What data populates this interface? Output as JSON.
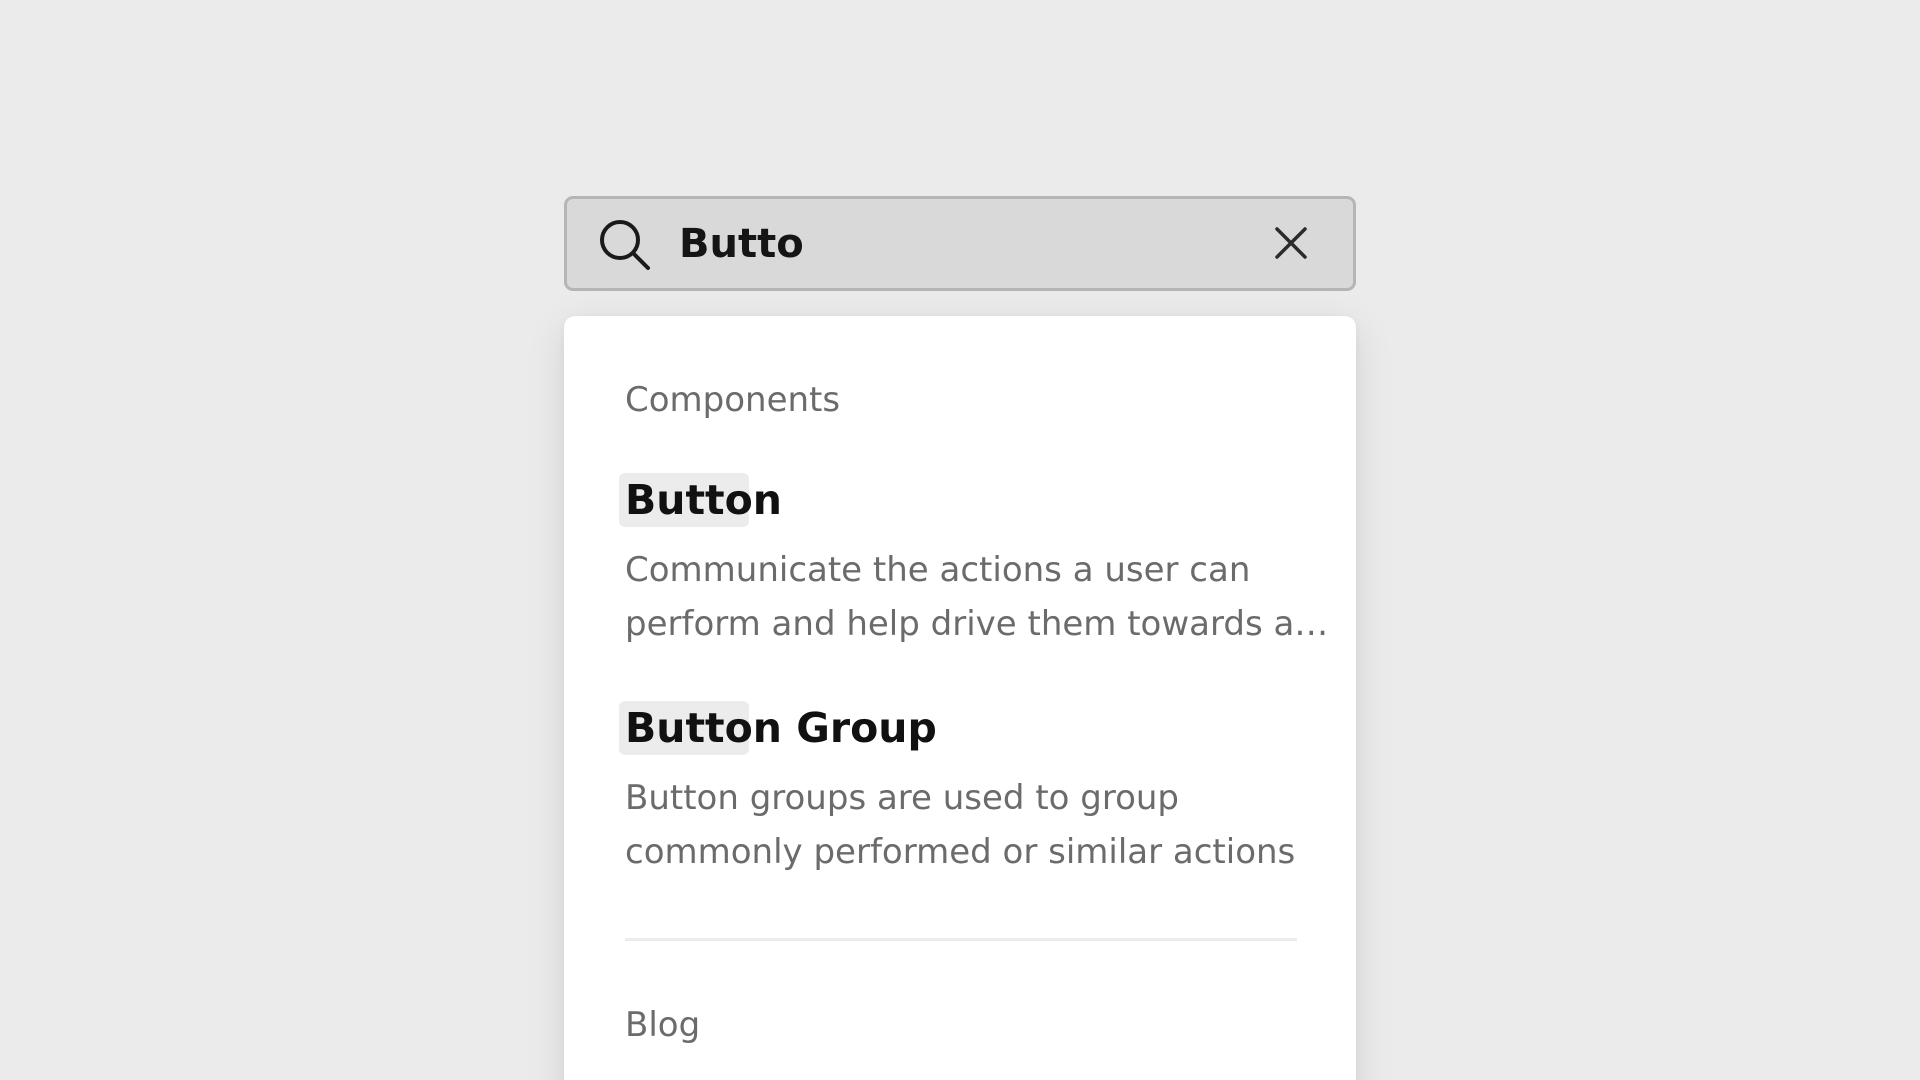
{
  "search": {
    "value": "Butto",
    "placeholder": ""
  },
  "results": {
    "sections": [
      {
        "label": "Components",
        "items": [
          {
            "title": "Button",
            "description_lines": [
              "Communicate the actions a user can",
              "perform and help drive them towards a…"
            ]
          },
          {
            "title": "Button Group",
            "description_lines": [
              "Button groups are used to group",
              "commonly performed or similar actions"
            ]
          }
        ]
      },
      {
        "label": "Blog",
        "items": []
      }
    ]
  },
  "icons": {
    "search": "search-icon",
    "clear": "close-icon"
  },
  "colors": {
    "background": "#ebebeb",
    "search_bar_bg": "#d9d9d9",
    "search_bar_border": "#b5b5b5",
    "panel_bg": "#ffffff",
    "highlight_bg": "#ececec",
    "title_text": "#111111",
    "secondary_text": "#6b6b6b"
  }
}
